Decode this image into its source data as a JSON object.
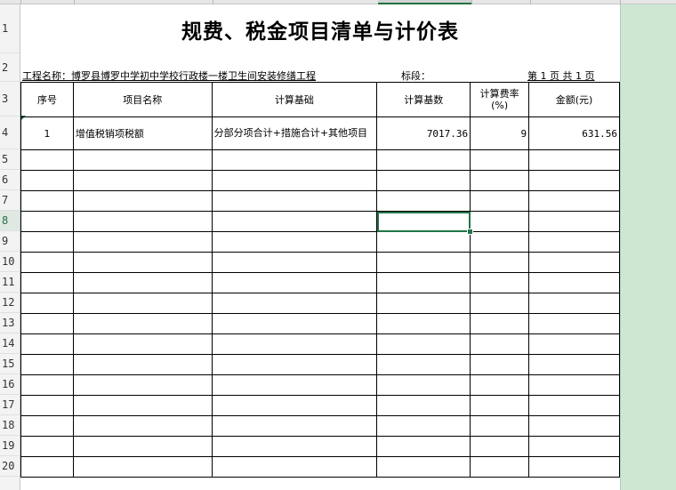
{
  "title": "规费、税金项目清单与计价表",
  "project_line": "工程名称：博罗县博罗中学初中学校行政楼一楼卫生间安装修缮工程",
  "section_label": "标段：",
  "page_info": "第 1 页  共 1 页",
  "headers": [
    "序号",
    "项目名称",
    "计算基础",
    "计算基数",
    "计算费率(%)",
    "金额(元)"
  ],
  "rows": [
    {
      "no": "1",
      "name": "增值税销项税额",
      "basis": "分部分项合计+措施合计+其他项目",
      "base": "7017.36",
      "rate": "9",
      "amount": "631.56"
    }
  ],
  "row_numbers": [
    "1",
    "2",
    "3",
    "4",
    "5",
    "6",
    "7",
    "8",
    "9",
    "10",
    "11",
    "12",
    "13",
    "14",
    "15",
    "16",
    "17",
    "18",
    "19",
    "20"
  ],
  "selected_row": "8",
  "colors": {
    "accent": "#217346",
    "right_pane": "#cde7d2"
  }
}
